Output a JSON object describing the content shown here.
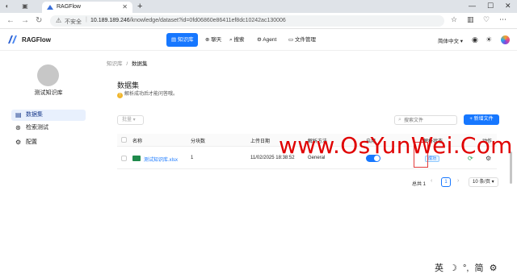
{
  "browser": {
    "tab_title": "RAGFlow",
    "insecure_label": "不安全",
    "url_host": "10.189.189.246",
    "url_path": "/knowledge/dataset?id=0fd06860e86411ef8dc10242ac130006"
  },
  "header": {
    "brand": "RAGFlow",
    "nav": [
      {
        "label": "知识库",
        "icon": "database-icon"
      },
      {
        "label": "聊天",
        "icon": "chat-icon"
      },
      {
        "label": "搜索",
        "icon": "search-icon"
      },
      {
        "label": "Agent",
        "icon": "agent-icon"
      },
      {
        "label": "文件管理",
        "icon": "folder-icon"
      }
    ],
    "language": "简体中文"
  },
  "sidebar": {
    "kb_name": "测试知识库",
    "items": [
      {
        "label": "数据集",
        "icon": "document-icon"
      },
      {
        "label": "检索测试",
        "icon": "retrieval-icon"
      },
      {
        "label": "配置",
        "icon": "gear-icon"
      }
    ]
  },
  "breadcrumb": {
    "root": "知识库",
    "sep": "/",
    "current": "数据集"
  },
  "main": {
    "title": "数据集",
    "subtitle": "解析成功后才能问答哦。",
    "bulk_label": "批量",
    "search_placeholder": "搜索文件",
    "new_file_label": "+ 新增文件",
    "columns": [
      "名称",
      "分块数",
      "上传日期",
      "解析方法",
      "启用",
      "解析状态",
      "动作"
    ],
    "rows": [
      {
        "name": "测试知识库.xlsx",
        "chunks": "1",
        "upload_date": "11/02/2025 18:38:52",
        "parse_method": "General",
        "enabled": true,
        "status": "成功"
      }
    ],
    "pagination": {
      "total_label": "总共 1",
      "current_page": "1",
      "page_size": "10 条/页"
    }
  },
  "watermark": "www.OsYunWei.Com",
  "taskbar": [
    "英",
    "☽",
    "°,",
    "简",
    "⚙"
  ],
  "colors": {
    "primary": "#1677ff",
    "watermark": "#e00000"
  }
}
